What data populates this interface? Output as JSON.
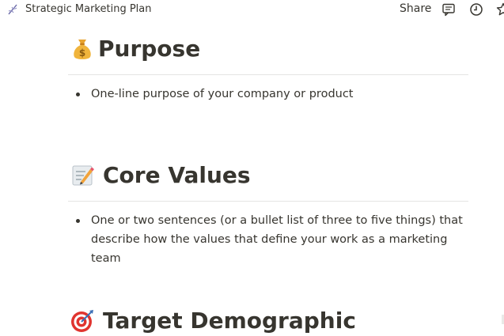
{
  "topbar": {
    "page_icon": "dna-icon",
    "title": "Strategic Marketing Plan",
    "share_label": "Share",
    "icons": [
      "comment-icon",
      "clock-icon",
      "star-icon"
    ]
  },
  "sections": [
    {
      "emoji": "money-bag-icon",
      "title": "Purpose",
      "bullet": "One-line purpose of your company or product"
    },
    {
      "emoji": "memo-icon",
      "title": "Core Values",
      "bullet_lines": [
        "One or two sentences (or a bullet list of three to five things) that",
        "describe how the values that define your work as a marketing team"
      ]
    },
    {
      "emoji": "target-icon",
      "title": "Target Demographic"
    }
  ],
  "colors": {
    "text": "#37352f",
    "divider": "#e5e5e3",
    "money_bag": "#f0b43c",
    "target_red": "#e0342f"
  }
}
